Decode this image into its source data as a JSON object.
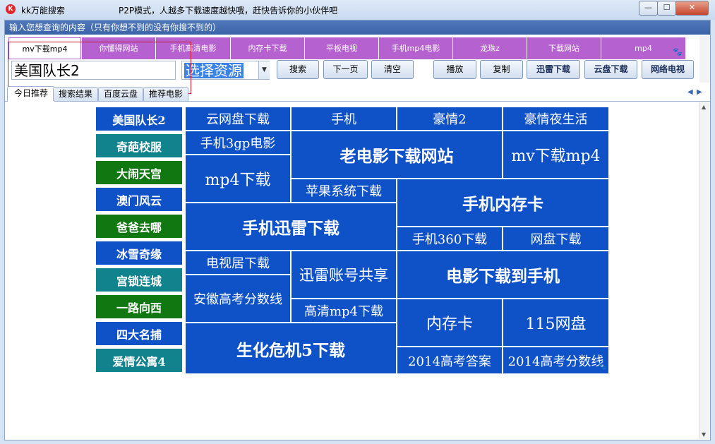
{
  "window": {
    "app_title": "kk万能搜索",
    "slogan": "P2P模式，人越多下载速度越快哦，赶快告诉你的小伙伴吧",
    "buttons": {
      "minimize": "—",
      "maximize": "☐",
      "close": "✕"
    }
  },
  "hint": "输入您想查询的内容（只有你想不到的没有你搜不到的）",
  "quick_tabs": [
    "mv下载mp4",
    "你懂得网站",
    "手机高清电影",
    "内存卡下载",
    "平板电视",
    "手机mp4电影",
    "龙珠z",
    "下载网站",
    "mp4"
  ],
  "search": {
    "value": "美国队长2",
    "resource_select": "选择资源"
  },
  "buttons": {
    "search": "搜索",
    "next_page": "下一页",
    "clear": "清空",
    "play": "播放",
    "copy": "复制",
    "xunlei": "迅雷下载",
    "cloud": "云盘下载",
    "tv": "网络电视"
  },
  "tabs": [
    "今日推荐",
    "搜索结果",
    "百度云盘",
    "推荐电影"
  ],
  "left_list": [
    {
      "label": "美国队长2",
      "color": "blue"
    },
    {
      "label": "奇葩校服",
      "color": "teal"
    },
    {
      "label": "大闹天宫",
      "color": "green"
    },
    {
      "label": "澳门风云",
      "color": "blue"
    },
    {
      "label": "爸爸去哪",
      "color": "green"
    },
    {
      "label": "冰雪奇缘",
      "color": "blue"
    },
    {
      "label": "宫锁连城",
      "color": "teal"
    },
    {
      "label": "一路向西",
      "color": "green"
    },
    {
      "label": "四大名捕",
      "color": "blue"
    },
    {
      "label": "爱情公寓4",
      "color": "teal"
    }
  ],
  "tiles": {
    "t1": "云网盘下载",
    "t2": "手机",
    "t3": "豪情2",
    "t4": "豪情夜生活",
    "t5": "手机3gp电影",
    "t6": "老电影下载网站",
    "t7": "mv下载mp4",
    "t8": "mp4下载",
    "t9": "苹果系统下载",
    "t10": "手机内存卡",
    "t11": "手机迅雷下载",
    "t12": "手机360下载",
    "t13": "网盘下载",
    "t14": "电视居下载",
    "t15": "迅雷账号共享",
    "t16": "电影下载到手机",
    "t17": "安徽高考分数线",
    "t18": "高清mp4下载",
    "t19": "内存卡",
    "t20": "115网盘",
    "t21": "生化危机5下载",
    "t22": "2014高考答案",
    "t23": "2014高考分数线"
  },
  "colors": {
    "blue": "#0f52c8",
    "teal": "#11838d",
    "green": "#117711",
    "purple": "#b561cf"
  }
}
